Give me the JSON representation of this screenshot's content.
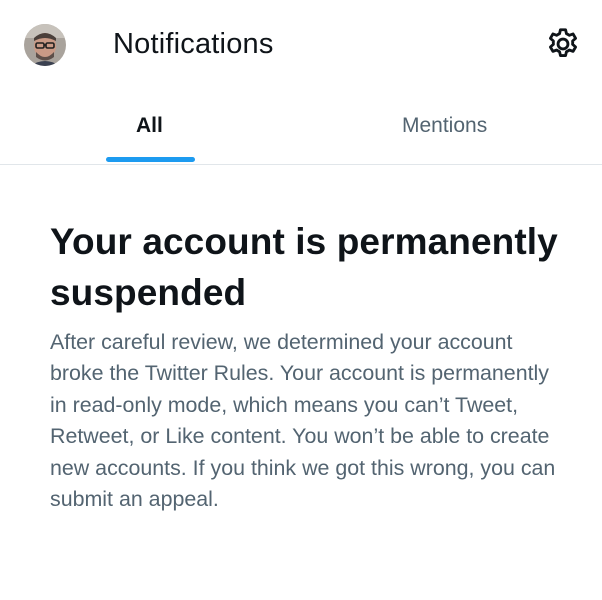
{
  "header": {
    "title": "Notifications",
    "avatar_icon": "user-avatar",
    "settings_icon": "gear-icon"
  },
  "tabs": [
    {
      "label": "All",
      "selected": true
    },
    {
      "label": "Mentions",
      "selected": false
    }
  ],
  "notice": {
    "title": "Your account is permanently suspended",
    "body": "After careful review, we determined your account broke the Twitter Rules. Your account is permanently in read-only mode, which means you can’t Tweet, Retweet, or Like content. You won’t be able to create new accounts. If you think we got this wrong, you can submit an appeal."
  },
  "colors": {
    "accent": "#1d9bf0",
    "text_primary": "#0f1419",
    "text_secondary": "#536471",
    "divider": "#e1e6ea"
  }
}
